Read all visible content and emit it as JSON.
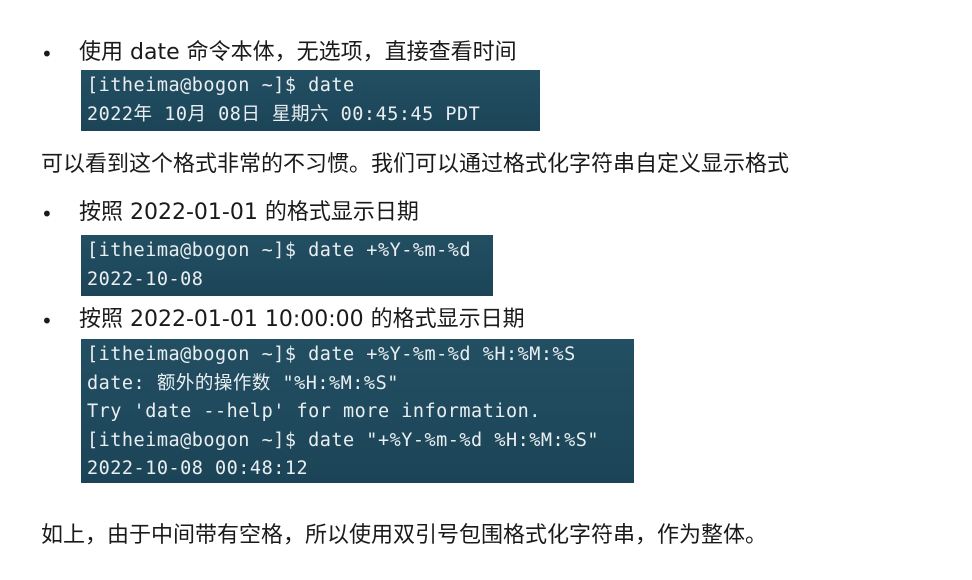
{
  "sections": [
    {
      "bullet": "•",
      "text": "使用 date 命令本体，无选项，直接查看时间",
      "terminal": [
        "[itheima@bogon ~]$ date",
        "2022年 10月 08日 星期六 00:45:45 PDT"
      ]
    },
    {
      "paragraph": "可以看到这个格式非常的不习惯。我们可以通过格式化字符串自定义显示格式"
    },
    {
      "bullet": "•",
      "text": "按照 2022-01-01 的格式显示日期",
      "terminal": [
        "[itheima@bogon ~]$ date +%Y-%m-%d",
        "2022-10-08"
      ]
    },
    {
      "bullet": "•",
      "text": "按照 2022-01-01 10:00:00 的格式显示日期",
      "terminal": [
        "[itheima@bogon ~]$ date +%Y-%m-%d %H:%M:%S",
        "date: 额外的操作数 \"%H:%M:%S\"",
        "Try 'date --help' for more information.",
        "[itheima@bogon ~]$ date \"+%Y-%m-%d %H:%M:%S\"",
        "2022-10-08 00:48:12"
      ]
    },
    {
      "paragraph": "如上，由于中间带有空格，所以使用双引号包围格式化字符串，作为整体。"
    }
  ]
}
